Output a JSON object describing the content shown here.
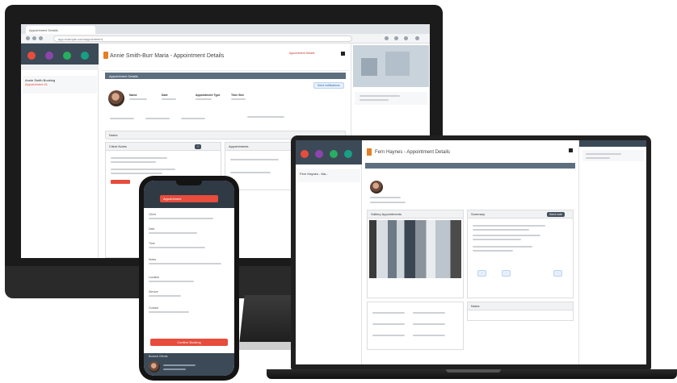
{
  "monitor": {
    "browser_tab": "Appointment Details",
    "url": "app.example.com/appointment",
    "page_title": "Annie Smith-Burr Maria - Appointment Details",
    "status": "Appointment Details",
    "section_label": "Appointment Details",
    "action_label": "Send notifications",
    "fields": [
      "Name",
      "Date",
      "Appointment Type",
      "Time Slot"
    ],
    "left_heading": "Client Notes",
    "right_heading": "Appointments",
    "notes_label": "Notes",
    "list_item_title": "Annie Smith Booking",
    "list_item_sub": "Appointment #1"
  },
  "laptop": {
    "page_title": "Fern Haynes - Appointment Details",
    "sidebar_item": "Fern Haynes - Ma...",
    "photo_heading": "Gallery Appointments",
    "summary_heading": "Summary",
    "notes_heading": "Notes",
    "action_label": "Send note"
  },
  "phone": {
    "header_title": "Appointment",
    "rows": [
      "Client",
      "Date",
      "Time",
      "Notes",
      "Location",
      "Service",
      "Contact"
    ],
    "cta_label": "Confirm Booking",
    "footer_label": "Booked Clients"
  },
  "colors": {
    "accent_red": "#e74c3c",
    "header_slate": "#3c4a57",
    "bar_slate": "#5d6e7f"
  }
}
